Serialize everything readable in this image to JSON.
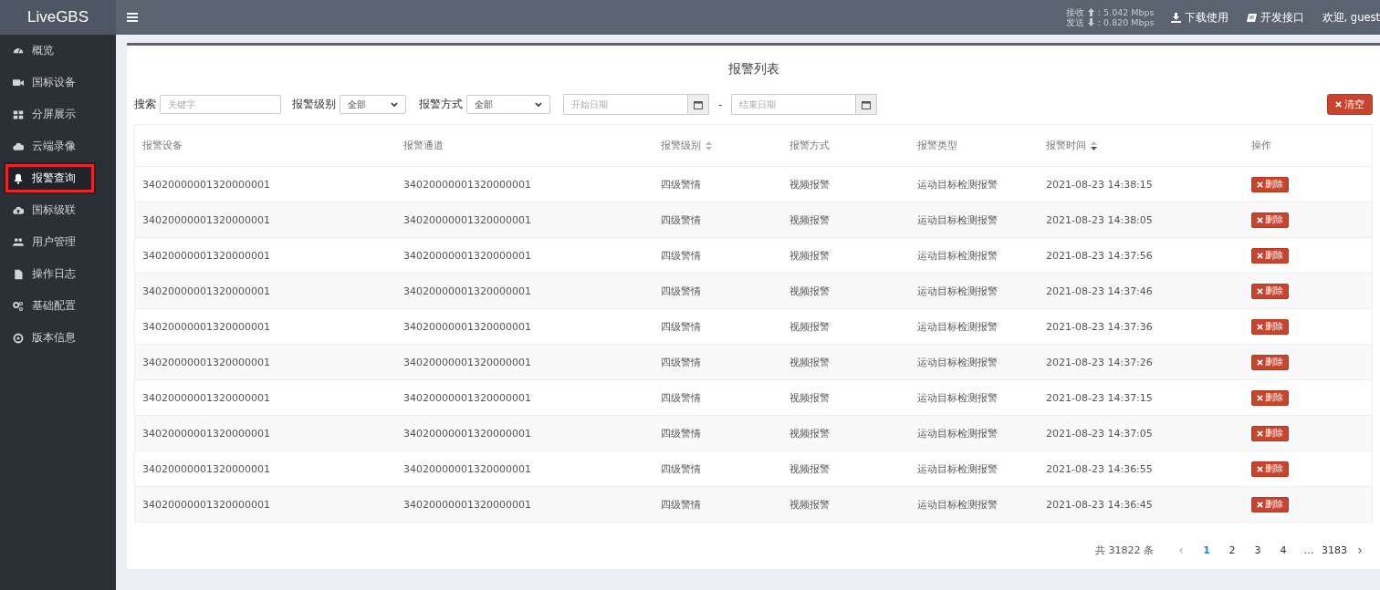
{
  "brand": "LiveGBS",
  "header": {
    "rx_label": "接收",
    "rx_value": ": 5.042 Mbps",
    "tx_label": "发送",
    "tx_value": ": 0.820 Mbps",
    "links": [
      "下载使用",
      "开发接口"
    ],
    "welcome": "欢迎, guest"
  },
  "sidebar": {
    "items": [
      {
        "label": "概览",
        "selected": false,
        "annotated": false
      },
      {
        "label": "国标设备",
        "selected": false,
        "annotated": false
      },
      {
        "label": "分屏展示",
        "selected": false,
        "annotated": false
      },
      {
        "label": "云端录像",
        "selected": false,
        "annotated": false
      },
      {
        "label": "报警查询",
        "selected": true,
        "annotated": true
      },
      {
        "label": "国标级联",
        "selected": false,
        "annotated": false
      },
      {
        "label": "用户管理",
        "selected": false,
        "annotated": false
      },
      {
        "label": "操作日志",
        "selected": false,
        "annotated": false
      },
      {
        "label": "基础配置",
        "selected": false,
        "annotated": false
      },
      {
        "label": "版本信息",
        "selected": false,
        "annotated": false
      }
    ]
  },
  "page_title": "报警列表",
  "filters": {
    "search_label": "搜索",
    "search_placeholder": "关键字",
    "level_label": "报警级别",
    "level_value": "全部",
    "method_label": "报警方式",
    "method_value": "全部",
    "start_placeholder": "开始日期",
    "separator": "-",
    "end_placeholder": "结束日期",
    "clear_button": "清空"
  },
  "table": {
    "columns": [
      {
        "label": "报警设备",
        "sortable": false
      },
      {
        "label": "报警通道",
        "sortable": false
      },
      {
        "label": "报警级别",
        "sortable": true,
        "sorted_descending": false
      },
      {
        "label": "报警方式",
        "sortable": false
      },
      {
        "label": "报警类型",
        "sortable": false
      },
      {
        "label": "报警时间",
        "sortable": true,
        "sorted_descending": true
      },
      {
        "label": "操作",
        "sortable": false
      }
    ],
    "rows": [
      {
        "device": "34020000001320000001",
        "channel": "34020000001320000001",
        "level": "四级警情",
        "method": "视频报警",
        "type": "运动目标检测报警",
        "time": "2021-08-23 14:38:15",
        "action": "删除"
      },
      {
        "device": "34020000001320000001",
        "channel": "34020000001320000001",
        "level": "四级警情",
        "method": "视频报警",
        "type": "运动目标检测报警",
        "time": "2021-08-23 14:38:05",
        "action": "删除"
      },
      {
        "device": "34020000001320000001",
        "channel": "34020000001320000001",
        "level": "四级警情",
        "method": "视频报警",
        "type": "运动目标检测报警",
        "time": "2021-08-23 14:37:56",
        "action": "删除"
      },
      {
        "device": "34020000001320000001",
        "channel": "34020000001320000001",
        "level": "四级警情",
        "method": "视频报警",
        "type": "运动目标检测报警",
        "time": "2021-08-23 14:37:46",
        "action": "删除"
      },
      {
        "device": "34020000001320000001",
        "channel": "34020000001320000001",
        "level": "四级警情",
        "method": "视频报警",
        "type": "运动目标检测报警",
        "time": "2021-08-23 14:37:36",
        "action": "删除"
      },
      {
        "device": "34020000001320000001",
        "channel": "34020000001320000001",
        "level": "四级警情",
        "method": "视频报警",
        "type": "运动目标检测报警",
        "time": "2021-08-23 14:37:26",
        "action": "删除"
      },
      {
        "device": "34020000001320000001",
        "channel": "34020000001320000001",
        "level": "四级警情",
        "method": "视频报警",
        "type": "运动目标检测报警",
        "time": "2021-08-23 14:37:15",
        "action": "删除"
      },
      {
        "device": "34020000001320000001",
        "channel": "34020000001320000001",
        "level": "四级警情",
        "method": "视频报警",
        "type": "运动目标检测报警",
        "time": "2021-08-23 14:37:05",
        "action": "删除"
      },
      {
        "device": "34020000001320000001",
        "channel": "34020000001320000001",
        "level": "四级警情",
        "method": "视频报警",
        "type": "运动目标检测报警",
        "time": "2021-08-23 14:36:55",
        "action": "删除"
      },
      {
        "device": "34020000001320000001",
        "channel": "34020000001320000001",
        "level": "四级警情",
        "method": "视频报警",
        "type": "运动目标检测报警",
        "time": "2021-08-23 14:36:45",
        "action": "删除"
      }
    ]
  },
  "pagination": {
    "total": "共 31822 条",
    "prev": "‹",
    "pages": [
      {
        "label": "1",
        "selected": true
      },
      {
        "label": "2",
        "selected": false
      },
      {
        "label": "3",
        "selected": false
      },
      {
        "label": "4",
        "selected": false
      },
      {
        "label": "…",
        "selected": false
      },
      {
        "label": "3183",
        "selected": false
      }
    ],
    "next": "›"
  }
}
